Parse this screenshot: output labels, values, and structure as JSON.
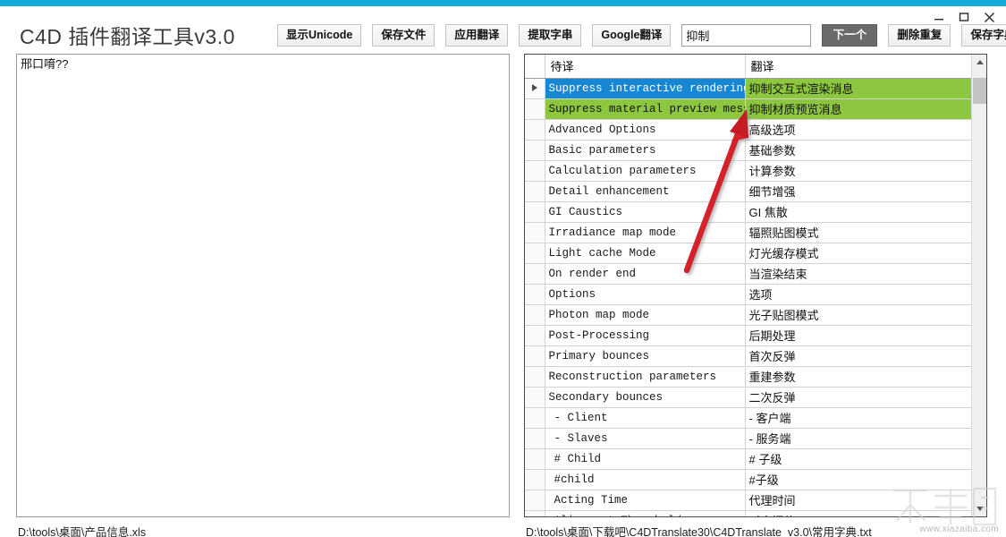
{
  "window": {
    "title": "C4D 插件翻译工具v3.0",
    "accent_color": "#13aad8",
    "minimize_label": "_",
    "maximize_label": "□",
    "close_label": "✕"
  },
  "toolbar": {
    "show_unicode": "显示Unicode",
    "save_file": "保存文件",
    "apply_translation": "应用翻译",
    "extract_strings": "提取字串",
    "google_translate": "Google翻译",
    "search_value": "抑制",
    "search_placeholder": "",
    "next": "下一个",
    "remove_duplicates": "删除重复",
    "save_dictionary": "保存字典"
  },
  "editor": {
    "content": "邢口唷??"
  },
  "grid": {
    "headers": {
      "selector": "",
      "source": "待译",
      "target": "翻译"
    },
    "rows": [
      {
        "marker": "▶",
        "source": "Suppress interactive rendering...",
        "target": "抑制交互式渲染消息",
        "state": "selected",
        "indent": true
      },
      {
        "marker": "",
        "source": "Suppress material preview mess...",
        "target": "抑制材质预览消息",
        "state": "match",
        "indent": true
      },
      {
        "marker": "",
        "source": "Advanced Options",
        "target": "高级选项",
        "state": "normal",
        "indent": true
      },
      {
        "marker": "",
        "source": "Basic parameters",
        "target": "基础参数",
        "state": "normal",
        "indent": true
      },
      {
        "marker": "",
        "source": "Calculation parameters",
        "target": "计算参数",
        "state": "normal",
        "indent": true
      },
      {
        "marker": "",
        "source": "Detail enhancement",
        "target": "细节增强",
        "state": "normal",
        "indent": true
      },
      {
        "marker": "",
        "source": "GI Caustics",
        "target": "GI 焦散",
        "state": "normal",
        "indent": true
      },
      {
        "marker": "",
        "source": "Irradiance map mode",
        "target": "辐照贴图模式",
        "state": "normal",
        "indent": true
      },
      {
        "marker": "",
        "source": "Light cache Mode",
        "target": "灯光缓存模式",
        "state": "normal",
        "indent": true
      },
      {
        "marker": "",
        "source": "On render end",
        "target": "当渲染结束",
        "state": "normal",
        "indent": true
      },
      {
        "marker": "",
        "source": "Options",
        "target": "选项",
        "state": "normal",
        "indent": true
      },
      {
        "marker": "",
        "source": "Photon map mode",
        "target": "光子贴图模式",
        "state": "normal",
        "indent": true
      },
      {
        "marker": "",
        "source": "Post-Processing",
        "target": "后期处理",
        "state": "normal",
        "indent": true
      },
      {
        "marker": "",
        "source": "Primary bounces",
        "target": "首次反弹",
        "state": "normal",
        "indent": true
      },
      {
        "marker": "",
        "source": "Reconstruction parameters",
        "target": "重建参数",
        "state": "normal",
        "indent": true
      },
      {
        "marker": "",
        "source": "Secondary bounces",
        "target": "二次反弹",
        "state": "normal",
        "indent": true
      },
      {
        "marker": "",
        "source": "- Client",
        "target": "- 客户端",
        "state": "normal",
        "indent": false
      },
      {
        "marker": "",
        "source": "- Slaves",
        "target": "- 服务端",
        "state": "normal",
        "indent": false
      },
      {
        "marker": "",
        "source": "# Child",
        "target": "# 子级",
        "state": "normal",
        "indent": false
      },
      {
        "marker": "",
        "source": "#child",
        "target": "#子级",
        "state": "normal",
        "indent": false
      },
      {
        "marker": "",
        "source": "Acting Time",
        "target": "代理时间",
        "state": "normal",
        "indent": false
      },
      {
        "marker": "",
        "source": "Alignment Threshold",
        "target": "对齐阈值",
        "state": "normal",
        "indent": false
      }
    ]
  },
  "status": {
    "left_path": "D:\\tools\\桌面\\产品信息.xls",
    "right_path": "D:\\tools\\桌面\\下载吧\\C4DTranslate30\\C4DTranslate_v3.0\\常用字典.txt"
  },
  "watermark": {
    "logo": "下载吧",
    "url": "www.xiazaiba.com"
  },
  "colors": {
    "accent": "#13aad8",
    "row_selected": "#1787d4",
    "row_match": "#8dc63f",
    "annotation_arrow": "#d3202a"
  }
}
